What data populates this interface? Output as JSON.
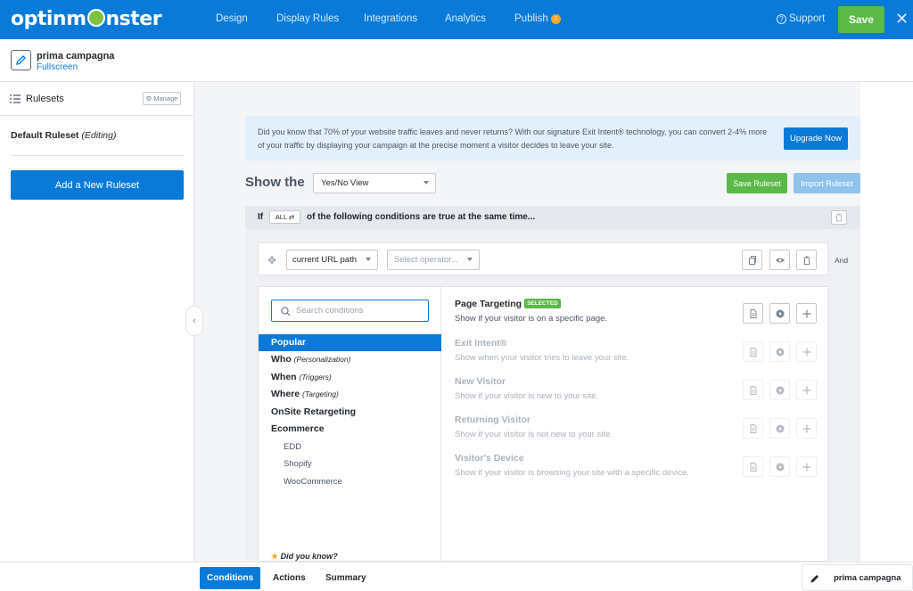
{
  "brand": {
    "logo_text_pre": "optinm",
    "logo_text_post": "nster",
    "primary": "#0a7ad9",
    "success": "#5bb947"
  },
  "nav": {
    "items": [
      "Design",
      "Display Rules",
      "Integrations",
      "Analytics",
      "Publish"
    ],
    "publish_badge_icon": "warning-icon",
    "support": "Support",
    "save": "Save"
  },
  "campaign": {
    "name": "prima campagna",
    "type": "Fullscreen"
  },
  "sidebar": {
    "title": "Rulesets",
    "manage": "Manage",
    "default_name": "Default Ruleset",
    "default_state": "(Editing)",
    "add_button": "Add a New Ruleset"
  },
  "promo": {
    "text": "Did you know that 70% of your website traffic leaves and never returns? With our signature Exit Intent® technology, you can convert 2-4% more of your traffic by displaying your campaign at the precise moment a visitor decides to leave your site.",
    "button": "Upgrade Now"
  },
  "show": {
    "label": "Show the",
    "view": "Yes/No View",
    "save_ruleset": "Save Ruleset",
    "import_ruleset": "Import Ruleset"
  },
  "condition_header": {
    "if": "If",
    "mode": "ALL ⇄",
    "text": "of the following conditions are true at the same time..."
  },
  "rule": {
    "field": "current URL path",
    "operator_placeholder": "Select operator...",
    "and": "And"
  },
  "picker": {
    "search_placeholder": "Search conditions",
    "categories": [
      {
        "label": "Popular",
        "hint": ""
      },
      {
        "label": "Who",
        "hint": "(Personalization)"
      },
      {
        "label": "When",
        "hint": "(Triggers)"
      },
      {
        "label": "Where",
        "hint": "(Targeting)"
      },
      {
        "label": "OnSite Retargeting",
        "hint": ""
      },
      {
        "label": "Ecommerce",
        "hint": ""
      }
    ],
    "subcategories": [
      "EDD",
      "Shopify",
      "WooCommerce"
    ],
    "did_you_know": "Did you know?",
    "options": [
      {
        "title": "Page Targeting",
        "badge": "SELECTED",
        "desc": "Show if your visitor is on a specific page."
      },
      {
        "title": "Exit Intent®",
        "badge": "",
        "desc": "Show when your visitor tries to leave your site."
      },
      {
        "title": "New Visitor",
        "badge": "",
        "desc": "Show if your visitor is new to your site."
      },
      {
        "title": "Returning Visitor",
        "badge": "",
        "desc": "Show if your visitor is not new to your site."
      },
      {
        "title": "Visitor's Device",
        "badge": "",
        "desc": "Show if your visitor is browsing your site with a specific device."
      }
    ]
  },
  "footer": {
    "tabs": [
      "Conditions",
      "Actions",
      "Summary"
    ],
    "campaign": "prima campagna"
  }
}
